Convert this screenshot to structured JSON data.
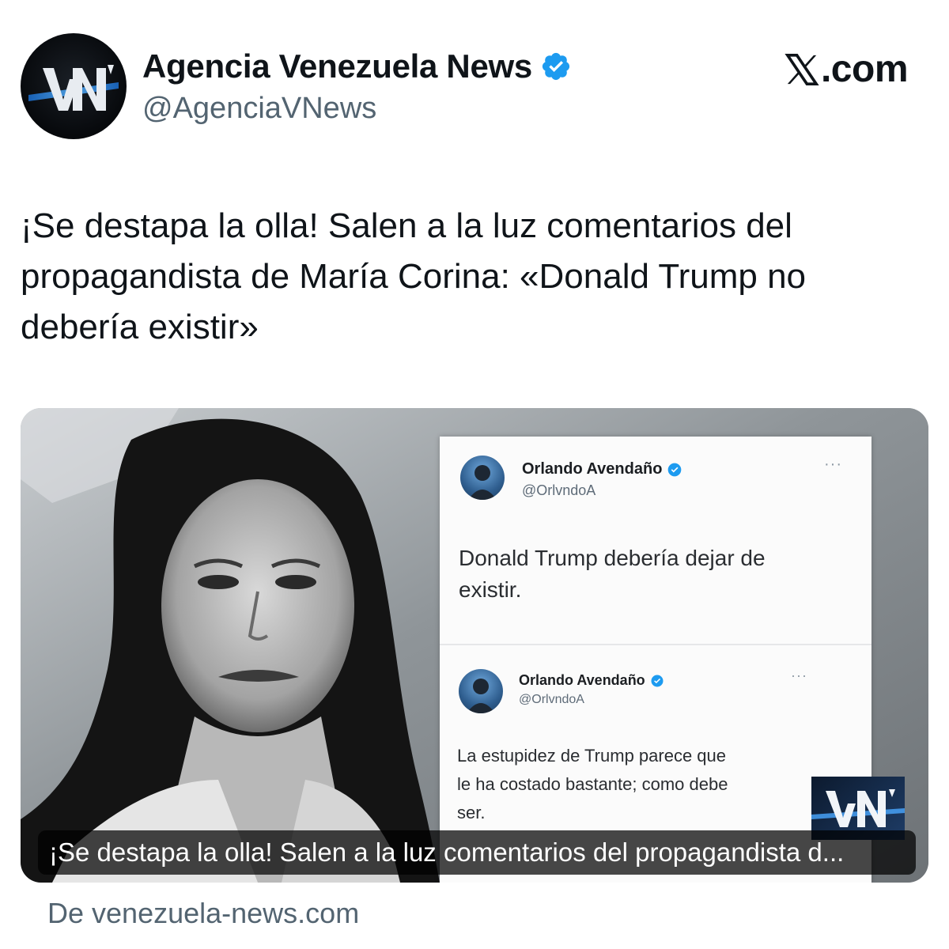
{
  "account": {
    "display_name": "Agencia Venezuela News",
    "handle": "@AgenciaVNews",
    "avatar_logo_text": "VN",
    "verified_icon": "verified-badge-icon",
    "verified_color": "#1d9bf0"
  },
  "brand": {
    "x_logo_icon": "x-logo-icon",
    "domain_suffix": ".com"
  },
  "tweet": {
    "text": "¡Se destapa la olla! Salen a la luz comentarios del propagandista de María Corina: «Donald Trump no debería existir»"
  },
  "media": {
    "quoted_tweets": [
      {
        "name": "Orlando Avendaño",
        "handle": "@OrlvndoA",
        "more": "···",
        "text_lines": [
          "Donald Trump debería dejar de",
          "existir."
        ]
      },
      {
        "name": "Orlando Avendaño",
        "handle": "@OrlvndoA",
        "more": "···",
        "text_lines": [
          "La estupidez de Trump parece que",
          "le ha costado bastante; como debe",
          "ser."
        ]
      }
    ],
    "watermark_text": "VN",
    "caption": "¡Se destapa la olla! Salen a la luz comentarios del propagandista d..."
  },
  "source": {
    "text": "De venezuela-news.com"
  }
}
